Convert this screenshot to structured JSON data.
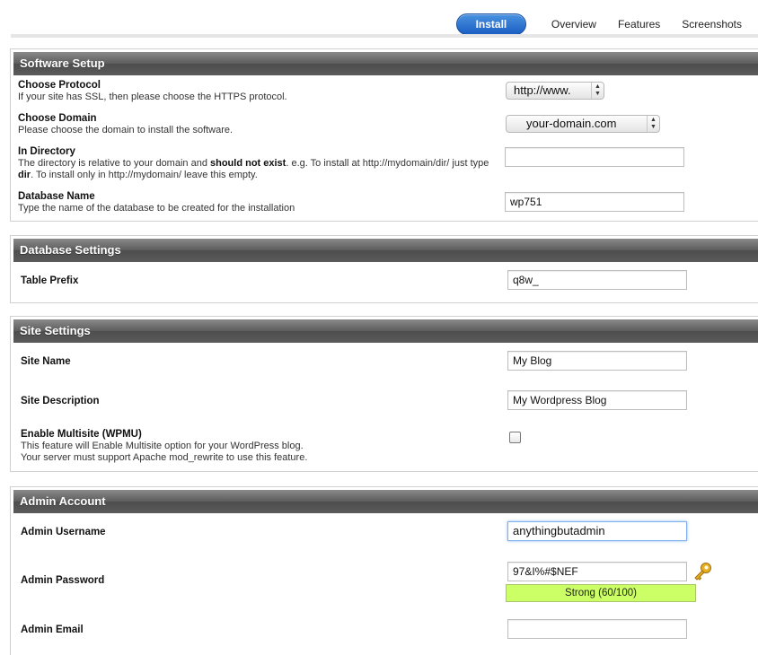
{
  "nav": {
    "install": "Install",
    "overview": "Overview",
    "features": "Features",
    "screenshots": "Screenshots"
  },
  "software_setup": {
    "title": "Software Setup",
    "protocol": {
      "label": "Choose Protocol",
      "desc": "If your site has SSL, then please choose the HTTPS protocol.",
      "value": "http://www."
    },
    "domain": {
      "label": "Choose Domain",
      "desc": "Please choose the domain to install the software.",
      "value": "your-domain.com"
    },
    "directory": {
      "label": "In Directory",
      "desc_part1": "The directory is relative to your domain and ",
      "desc_bold1": "should not exist",
      "desc_part2": ". e.g. To install at http://mydomain/dir/ just type ",
      "desc_bold2": "dir",
      "desc_part3": ". To install only in http://mydomain/ leave this empty.",
      "value": ""
    },
    "database": {
      "label": "Database Name",
      "desc": "Type the name of the database to be created for the installation",
      "value": "wp751"
    }
  },
  "database_settings": {
    "title": "Database Settings",
    "table_prefix": {
      "label": "Table Prefix",
      "value": "q8w_"
    }
  },
  "site_settings": {
    "title": "Site Settings",
    "site_name": {
      "label": "Site Name",
      "value": "My Blog"
    },
    "site_description": {
      "label": "Site Description",
      "value": "My Wordpress Blog"
    },
    "multisite": {
      "label": "Enable Multisite (WPMU)",
      "desc_line1": "This feature will Enable Multisite option for your WordPress blog.",
      "desc_line2": "Your server must support Apache mod_rewrite to use this feature.",
      "checked": false
    }
  },
  "admin_account": {
    "title": "Admin Account",
    "username": {
      "label": "Admin Username",
      "value": "anythingbutadmin"
    },
    "password": {
      "label": "Admin Password",
      "value": "97&I%#$NEF",
      "strength": "Strong (60/100)"
    },
    "email": {
      "label": "Admin Email",
      "value": ""
    }
  },
  "colors": {
    "accent": "#1b5fc4",
    "strength_bar": "#ccff66",
    "panel_header": "#5c5c5c"
  }
}
